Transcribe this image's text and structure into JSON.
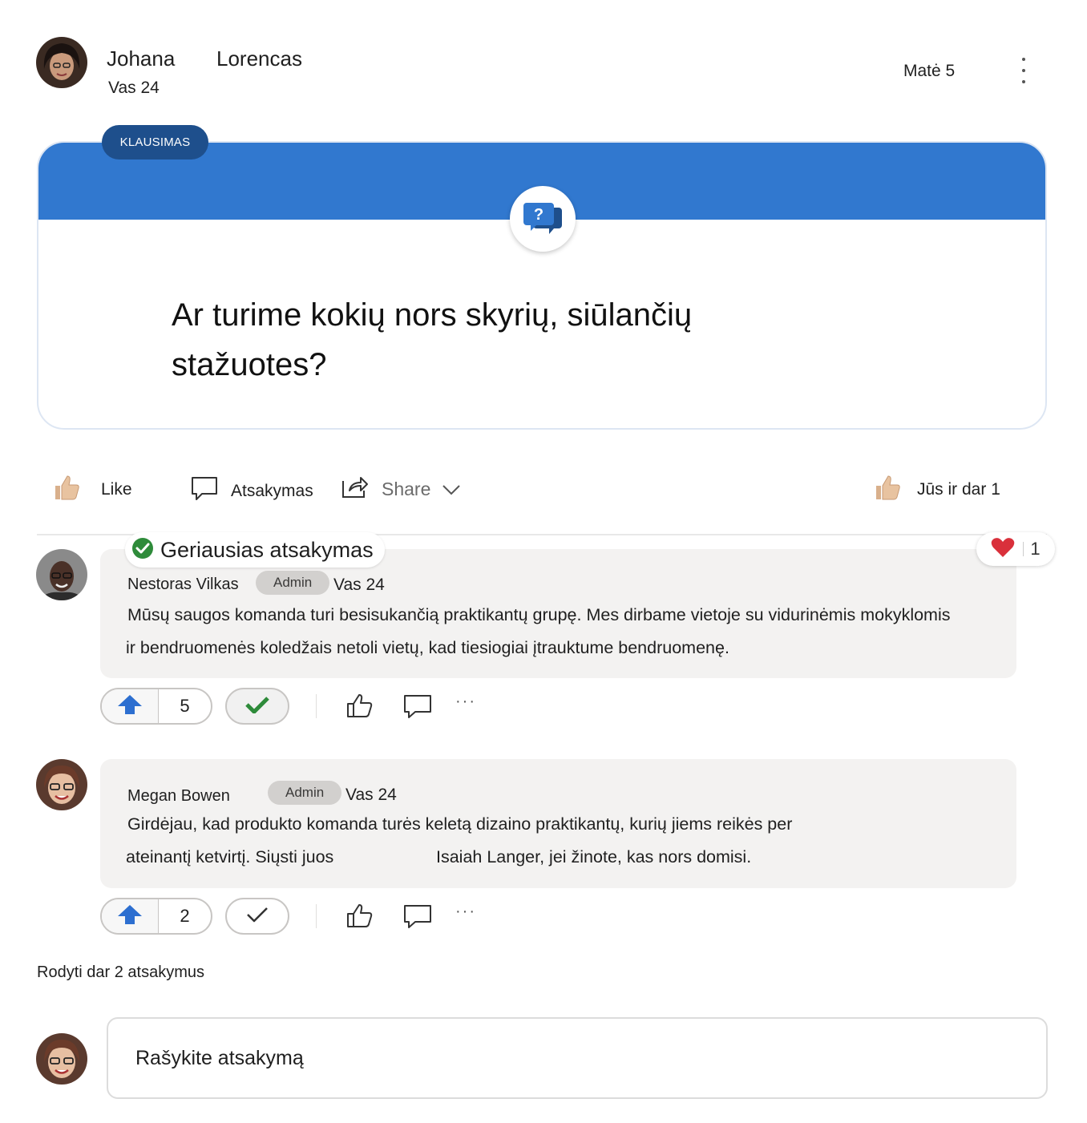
{
  "post": {
    "author_first": "Johana",
    "author_last": "Lorencas",
    "date": "Vas 24",
    "seen_by": "Matė 5",
    "tag": "KLAUSIMAS",
    "question": "Ar turime kokių nors skyrių, siūlančių stažuotes?"
  },
  "actions": {
    "like": "Like",
    "reply": "Atsakymas",
    "share": "Share",
    "reactors": "Jūs ir dar 1"
  },
  "replies": [
    {
      "best_answer_label": "Geriausias atsakymas",
      "author": "Nestoras Vilkas",
      "badge": "Admin",
      "date": "Vas 24",
      "body_line1": "Mūsų saugos komanda turi besisukančią praktikantų grupę. Mes dirbame vietoje su vidurinėmis mokyklomis",
      "body_line2": "ir bendruomenės koledžais netoli vietų, kad tiesiogiai įtrauktume bendruomenę.",
      "reaction_count": "1",
      "upvotes": "5"
    },
    {
      "author": "Megan Bowen",
      "badge": "Admin",
      "date": "Vas 24",
      "body_line1": "Girdėjau, kad produkto komanda turės keletą dizaino praktikantų, kurių jiems reikės per",
      "body_line2a": "ateinantį ketvirtį. Siųsti juos",
      "body_line2b": "Isaiah Langer, jei žinote, kas nors domisi.",
      "upvotes": "2"
    }
  ],
  "show_more": "Rodyti dar 2 atsakymus",
  "composer": {
    "placeholder": "Rašykite atsakymą"
  },
  "colors": {
    "accent": "#3178cf",
    "tag_bg": "#1e4f8c",
    "success": "#2e8b3a",
    "heart": "#d9303b"
  },
  "icons": [
    "thumbs-up-icon",
    "comment-icon",
    "share-icon",
    "chevron-down-icon",
    "question-chat-icon",
    "check-circle-icon",
    "heart-icon",
    "arrow-up-icon",
    "checkmark-icon",
    "more-icon"
  ]
}
